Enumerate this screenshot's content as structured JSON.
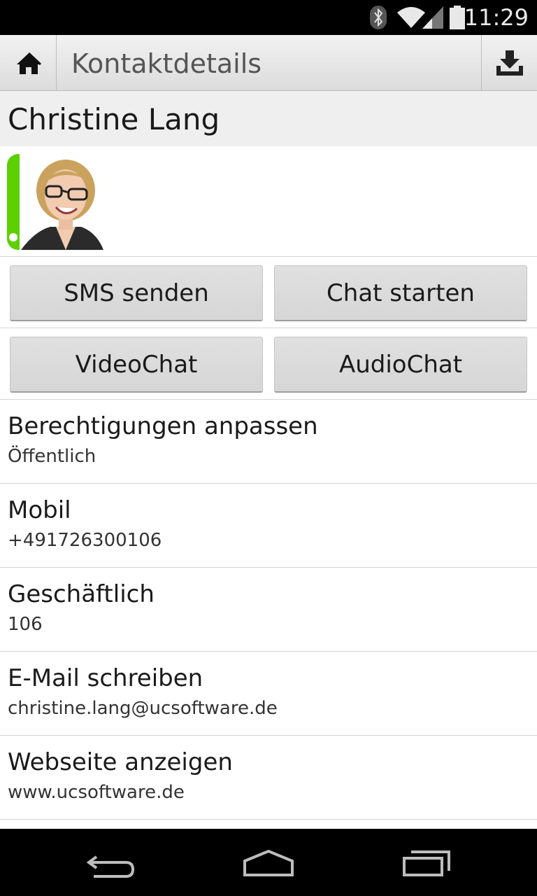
{
  "status_bar": {
    "time": "11:29",
    "icons": [
      "bluetooth-icon",
      "wifi-icon",
      "signal-icon",
      "battery-icon"
    ]
  },
  "action_bar": {
    "home_icon": "home-icon",
    "title": "Kontaktdetails",
    "download_icon": "download-icon"
  },
  "contact": {
    "name": "Christine Lang",
    "presence_color": "#5cd000"
  },
  "buttons": {
    "sms": "SMS senden",
    "chat": "Chat starten",
    "video": "VideoChat",
    "audio": "AudioChat"
  },
  "details": [
    {
      "label": "Berechtigungen anpassen",
      "value": "Öffentlich"
    },
    {
      "label": "Mobil",
      "value": "+491726300106"
    },
    {
      "label": "Geschäftlich",
      "value": "106"
    },
    {
      "label": "E-Mail schreiben",
      "value": "christine.lang@ucsoftware.de"
    },
    {
      "label": "Webseite anzeigen",
      "value": "www.ucsoftware.de"
    }
  ],
  "nav_bar": {
    "icons": [
      "back-icon",
      "home-nav-icon",
      "recent-apps-icon"
    ]
  }
}
